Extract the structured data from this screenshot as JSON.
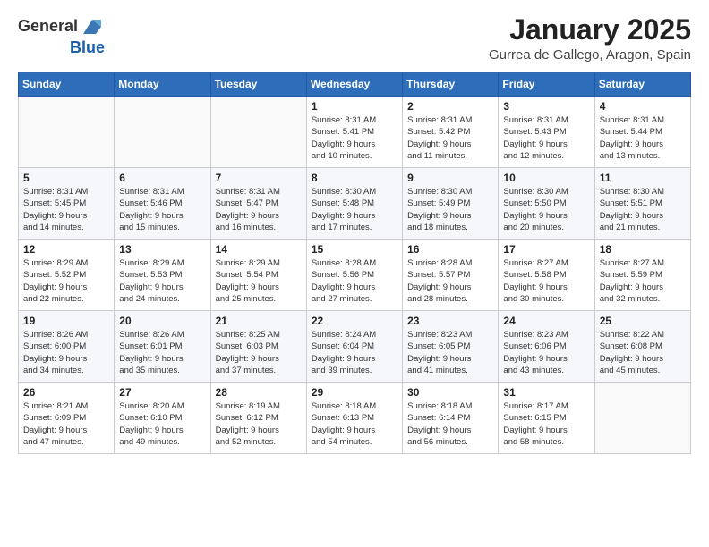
{
  "logo": {
    "general": "General",
    "blue": "Blue"
  },
  "header": {
    "month": "January 2025",
    "location": "Gurrea de Gallego, Aragon, Spain"
  },
  "weekdays": [
    "Sunday",
    "Monday",
    "Tuesday",
    "Wednesday",
    "Thursday",
    "Friday",
    "Saturday"
  ],
  "weeks": [
    [
      {
        "day": "",
        "info": ""
      },
      {
        "day": "",
        "info": ""
      },
      {
        "day": "",
        "info": ""
      },
      {
        "day": "1",
        "info": "Sunrise: 8:31 AM\nSunset: 5:41 PM\nDaylight: 9 hours\nand 10 minutes."
      },
      {
        "day": "2",
        "info": "Sunrise: 8:31 AM\nSunset: 5:42 PM\nDaylight: 9 hours\nand 11 minutes."
      },
      {
        "day": "3",
        "info": "Sunrise: 8:31 AM\nSunset: 5:43 PM\nDaylight: 9 hours\nand 12 minutes."
      },
      {
        "day": "4",
        "info": "Sunrise: 8:31 AM\nSunset: 5:44 PM\nDaylight: 9 hours\nand 13 minutes."
      }
    ],
    [
      {
        "day": "5",
        "info": "Sunrise: 8:31 AM\nSunset: 5:45 PM\nDaylight: 9 hours\nand 14 minutes."
      },
      {
        "day": "6",
        "info": "Sunrise: 8:31 AM\nSunset: 5:46 PM\nDaylight: 9 hours\nand 15 minutes."
      },
      {
        "day": "7",
        "info": "Sunrise: 8:31 AM\nSunset: 5:47 PM\nDaylight: 9 hours\nand 16 minutes."
      },
      {
        "day": "8",
        "info": "Sunrise: 8:30 AM\nSunset: 5:48 PM\nDaylight: 9 hours\nand 17 minutes."
      },
      {
        "day": "9",
        "info": "Sunrise: 8:30 AM\nSunset: 5:49 PM\nDaylight: 9 hours\nand 18 minutes."
      },
      {
        "day": "10",
        "info": "Sunrise: 8:30 AM\nSunset: 5:50 PM\nDaylight: 9 hours\nand 20 minutes."
      },
      {
        "day": "11",
        "info": "Sunrise: 8:30 AM\nSunset: 5:51 PM\nDaylight: 9 hours\nand 21 minutes."
      }
    ],
    [
      {
        "day": "12",
        "info": "Sunrise: 8:29 AM\nSunset: 5:52 PM\nDaylight: 9 hours\nand 22 minutes."
      },
      {
        "day": "13",
        "info": "Sunrise: 8:29 AM\nSunset: 5:53 PM\nDaylight: 9 hours\nand 24 minutes."
      },
      {
        "day": "14",
        "info": "Sunrise: 8:29 AM\nSunset: 5:54 PM\nDaylight: 9 hours\nand 25 minutes."
      },
      {
        "day": "15",
        "info": "Sunrise: 8:28 AM\nSunset: 5:56 PM\nDaylight: 9 hours\nand 27 minutes."
      },
      {
        "day": "16",
        "info": "Sunrise: 8:28 AM\nSunset: 5:57 PM\nDaylight: 9 hours\nand 28 minutes."
      },
      {
        "day": "17",
        "info": "Sunrise: 8:27 AM\nSunset: 5:58 PM\nDaylight: 9 hours\nand 30 minutes."
      },
      {
        "day": "18",
        "info": "Sunrise: 8:27 AM\nSunset: 5:59 PM\nDaylight: 9 hours\nand 32 minutes."
      }
    ],
    [
      {
        "day": "19",
        "info": "Sunrise: 8:26 AM\nSunset: 6:00 PM\nDaylight: 9 hours\nand 34 minutes."
      },
      {
        "day": "20",
        "info": "Sunrise: 8:26 AM\nSunset: 6:01 PM\nDaylight: 9 hours\nand 35 minutes."
      },
      {
        "day": "21",
        "info": "Sunrise: 8:25 AM\nSunset: 6:03 PM\nDaylight: 9 hours\nand 37 minutes."
      },
      {
        "day": "22",
        "info": "Sunrise: 8:24 AM\nSunset: 6:04 PM\nDaylight: 9 hours\nand 39 minutes."
      },
      {
        "day": "23",
        "info": "Sunrise: 8:23 AM\nSunset: 6:05 PM\nDaylight: 9 hours\nand 41 minutes."
      },
      {
        "day": "24",
        "info": "Sunrise: 8:23 AM\nSunset: 6:06 PM\nDaylight: 9 hours\nand 43 minutes."
      },
      {
        "day": "25",
        "info": "Sunrise: 8:22 AM\nSunset: 6:08 PM\nDaylight: 9 hours\nand 45 minutes."
      }
    ],
    [
      {
        "day": "26",
        "info": "Sunrise: 8:21 AM\nSunset: 6:09 PM\nDaylight: 9 hours\nand 47 minutes."
      },
      {
        "day": "27",
        "info": "Sunrise: 8:20 AM\nSunset: 6:10 PM\nDaylight: 9 hours\nand 49 minutes."
      },
      {
        "day": "28",
        "info": "Sunrise: 8:19 AM\nSunset: 6:12 PM\nDaylight: 9 hours\nand 52 minutes."
      },
      {
        "day": "29",
        "info": "Sunrise: 8:18 AM\nSunset: 6:13 PM\nDaylight: 9 hours\nand 54 minutes."
      },
      {
        "day": "30",
        "info": "Sunrise: 8:18 AM\nSunset: 6:14 PM\nDaylight: 9 hours\nand 56 minutes."
      },
      {
        "day": "31",
        "info": "Sunrise: 8:17 AM\nSunset: 6:15 PM\nDaylight: 9 hours\nand 58 minutes."
      },
      {
        "day": "",
        "info": ""
      }
    ]
  ]
}
